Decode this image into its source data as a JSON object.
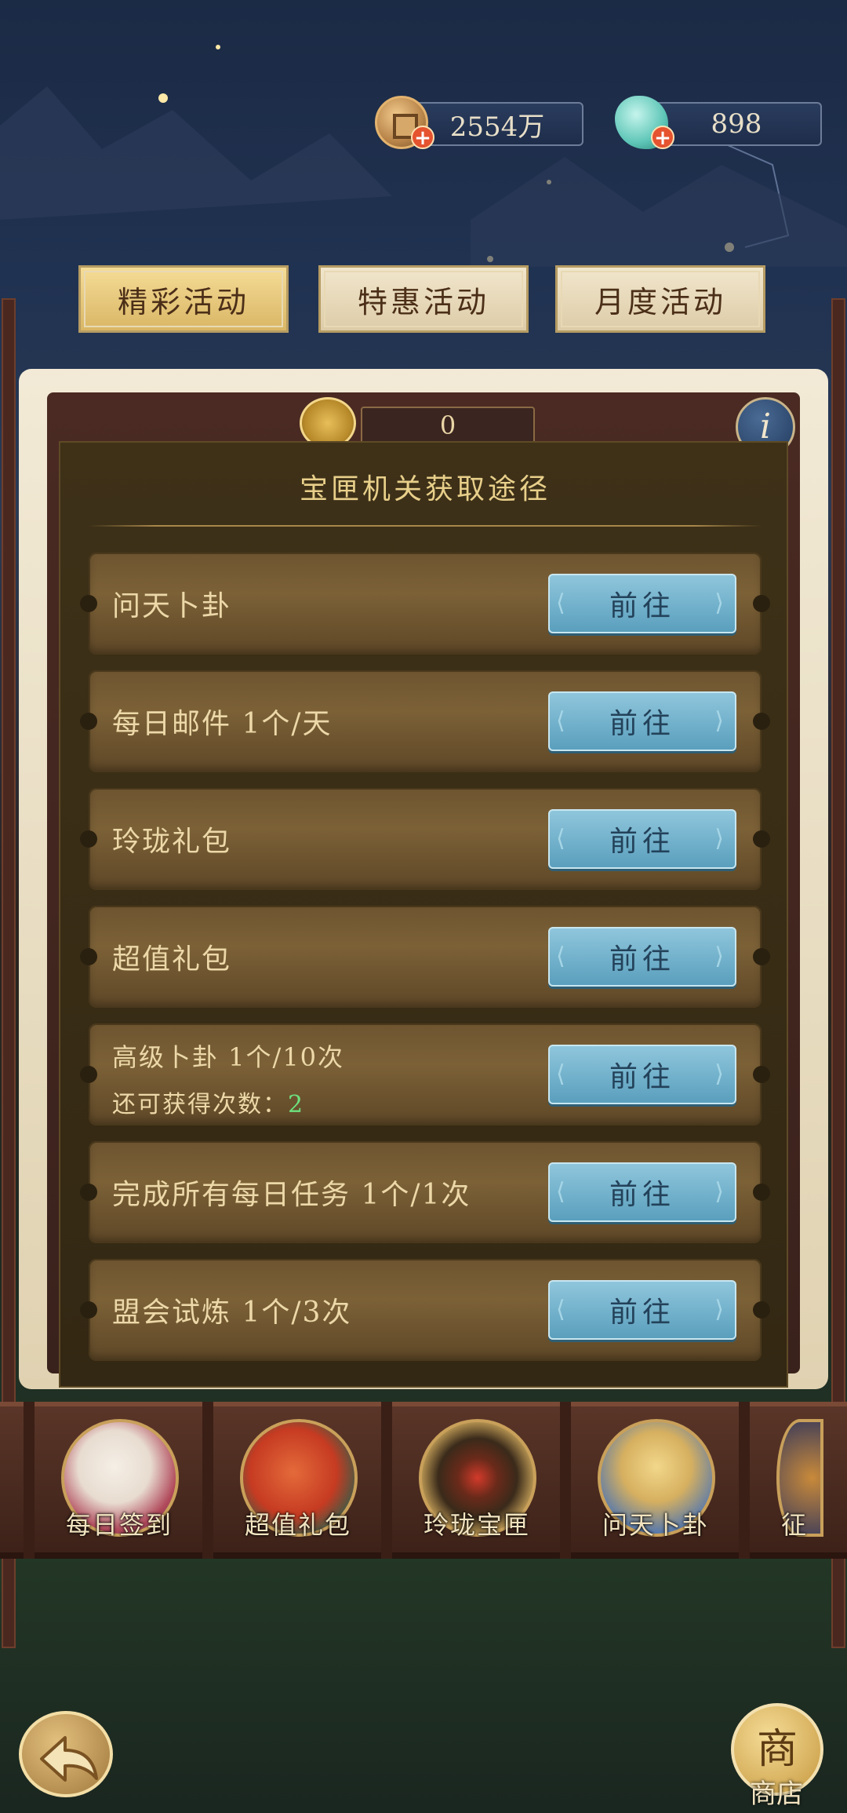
{
  "currencies": [
    {
      "name": "coin",
      "value": "2554万",
      "icon": "copper-coin-icon"
    },
    {
      "name": "jade",
      "value": "898",
      "icon": "jade-shell-icon"
    }
  ],
  "tabs": [
    {
      "label": "精彩活动",
      "active": true
    },
    {
      "label": "特惠活动",
      "active": false
    },
    {
      "label": "月度活动",
      "active": false
    }
  ],
  "counter": {
    "value": "0"
  },
  "info_button": {
    "label": "i"
  },
  "popup": {
    "title": "宝匣机关获取途径",
    "rows": [
      {
        "label": "问天卜卦",
        "button": "前往"
      },
      {
        "label": "每日邮件 1个/天",
        "button": "前往"
      },
      {
        "label": "玲珑礼包",
        "button": "前往"
      },
      {
        "label": "超值礼包",
        "button": "前往"
      },
      {
        "label": "高级卜卦 1个/10次",
        "sub_label": "还可获得次数：",
        "sub_count": "2",
        "button": "前往"
      },
      {
        "label": "完成所有每日任务 1个/1次",
        "button": "前往"
      },
      {
        "label": "盟会试炼 1个/3次",
        "button": "前往"
      }
    ]
  },
  "activities": [
    {
      "label": "每日签到",
      "icon": "calendar-icon"
    },
    {
      "label": "超值礼包",
      "icon": "gift-bag-icon"
    },
    {
      "label": "玲珑宝匣",
      "icon": "treasure-box-icon"
    },
    {
      "label": "问天卜卦",
      "icon": "divination-icon"
    },
    {
      "label": "征",
      "icon": "partial-activity-icon"
    }
  ],
  "footer": {
    "back_icon": "back-arrow-icon",
    "shop_glyph": "商",
    "shop_label": "商店"
  },
  "colors": {
    "tab_active": "#d9b665",
    "button_blue": "#5a9fbd",
    "count_green": "#6ee07e",
    "popup_bg": "#3e3118"
  }
}
